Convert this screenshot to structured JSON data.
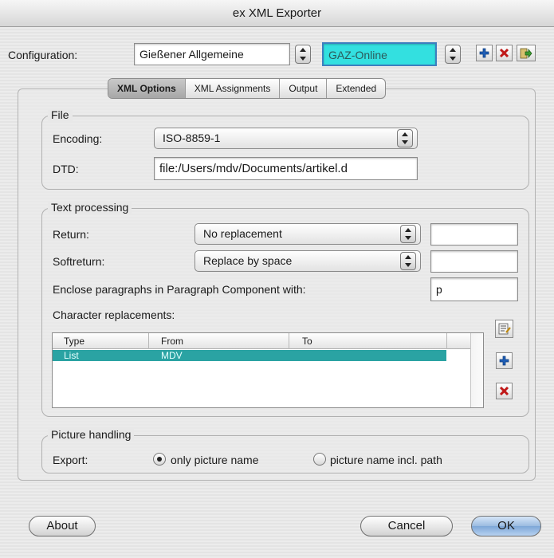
{
  "window": {
    "title": "ex XML Exporter"
  },
  "config": {
    "label": "Configuration:",
    "value1": "Gießener Allgemeine",
    "value2": "GAZ-Online",
    "highlight_color": "#33e0e0"
  },
  "tabs": [
    "XML Options",
    "XML Assignments",
    "Output",
    "Extended"
  ],
  "file": {
    "title": "File",
    "encoding_label": "Encoding:",
    "encoding_value": "ISO-8859-1",
    "dtd_label": "DTD:",
    "dtd_value": "file:/Users/mdv/Documents/artikel.d"
  },
  "text": {
    "title": "Text processing",
    "return_label": "Return:",
    "return_value": "No replacement",
    "return_field": "",
    "softreturn_label": "Softreturn:",
    "softreturn_value": "Replace by space",
    "softreturn_field": "",
    "enclose_label": "Enclose paragraphs in Paragraph Component with:",
    "enclose_value": "p",
    "charrep_label": "Character replacements:",
    "columns": [
      "Type",
      "From",
      "To"
    ],
    "rows": [
      {
        "type": "List",
        "from": "MDV",
        "to": ""
      }
    ],
    "selection_color": "#2aa3a3"
  },
  "picture": {
    "title": "Picture handling",
    "export_label": "Export:",
    "option1": "only picture name",
    "option2": "picture name incl. path",
    "selected": "option1"
  },
  "buttons": {
    "about": "About",
    "cancel": "Cancel",
    "ok": "OK"
  },
  "icons": {
    "add": "plus-icon",
    "delete": "x-icon",
    "import": "import-icon",
    "edit": "list-edit-icon"
  }
}
